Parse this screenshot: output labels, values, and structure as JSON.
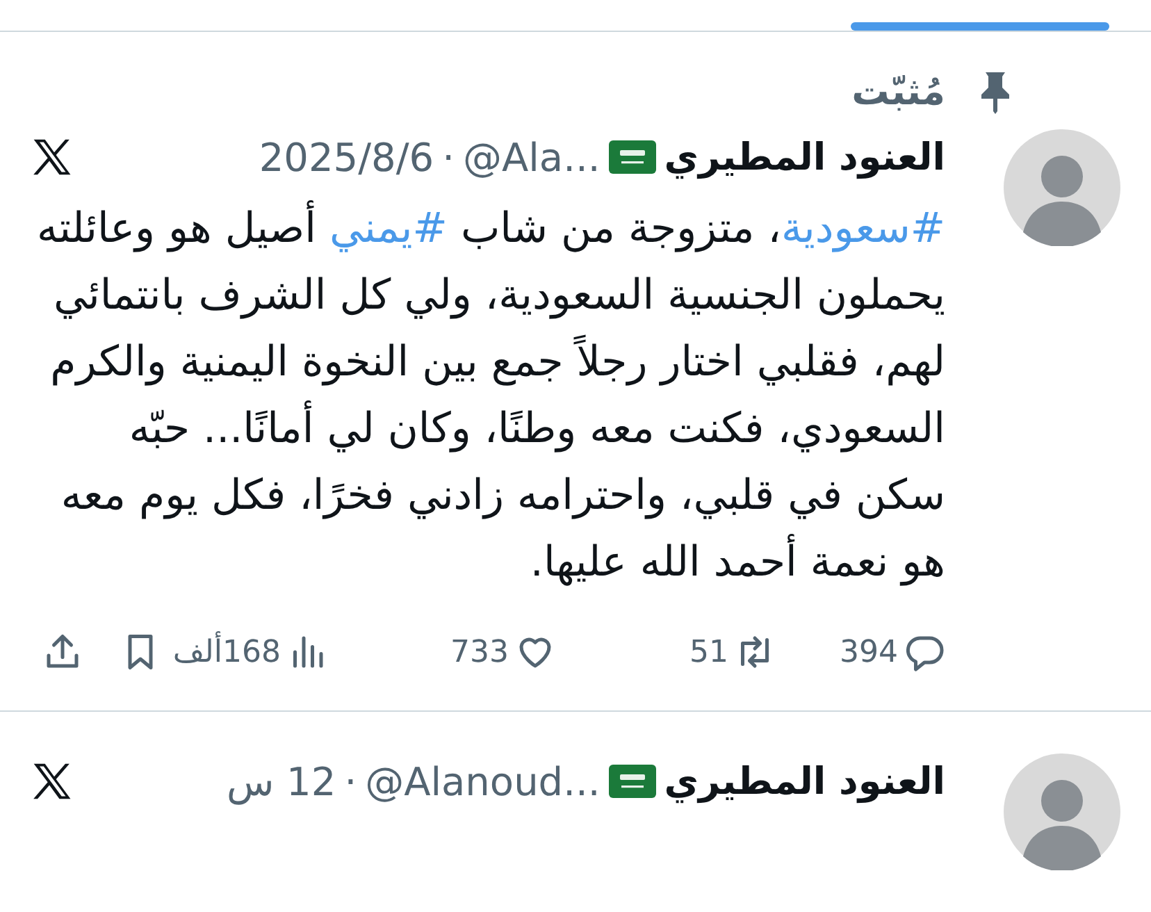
{
  "tweets": [
    {
      "pinned": {
        "label": "مُثبّت"
      },
      "name": "العنود المطيري",
      "handle": "@Ala...",
      "separator": "·",
      "time": "2025/8/6",
      "body": [
        {
          "kind": "hashtag",
          "text": "#سعودية"
        },
        {
          "kind": "text",
          "text": "، متزوجة من شاب "
        },
        {
          "kind": "hashtag",
          "text": "#يمني"
        },
        {
          "kind": "text",
          "text": " أصيل هو وعائلته يحملون الجنسية السعودية، ولي كل الشرف بانتمائي لهم، فقلبي اختار رجلاً جمع بين النخوة اليمنية والكرم السعودي، فكنت معه وطنًا، وكان لي أمانًا... حبّه سكن في قلبي، واحترامه زادني فخرًا، فكل يوم معه هو نعمة أحمد الله عليها."
        }
      ],
      "actions": [
        {
          "kind": "reply",
          "count": "394"
        },
        {
          "kind": "repost",
          "count": "51"
        },
        {
          "kind": "like",
          "count": "733"
        },
        {
          "kind": "views",
          "count": "168ألف"
        },
        {
          "kind": "bookmark"
        },
        {
          "kind": "share"
        }
      ]
    },
    {
      "name": "العنود المطيري",
      "handle": "@Alanoud...",
      "separator": "·",
      "time": "12 س"
    }
  ]
}
